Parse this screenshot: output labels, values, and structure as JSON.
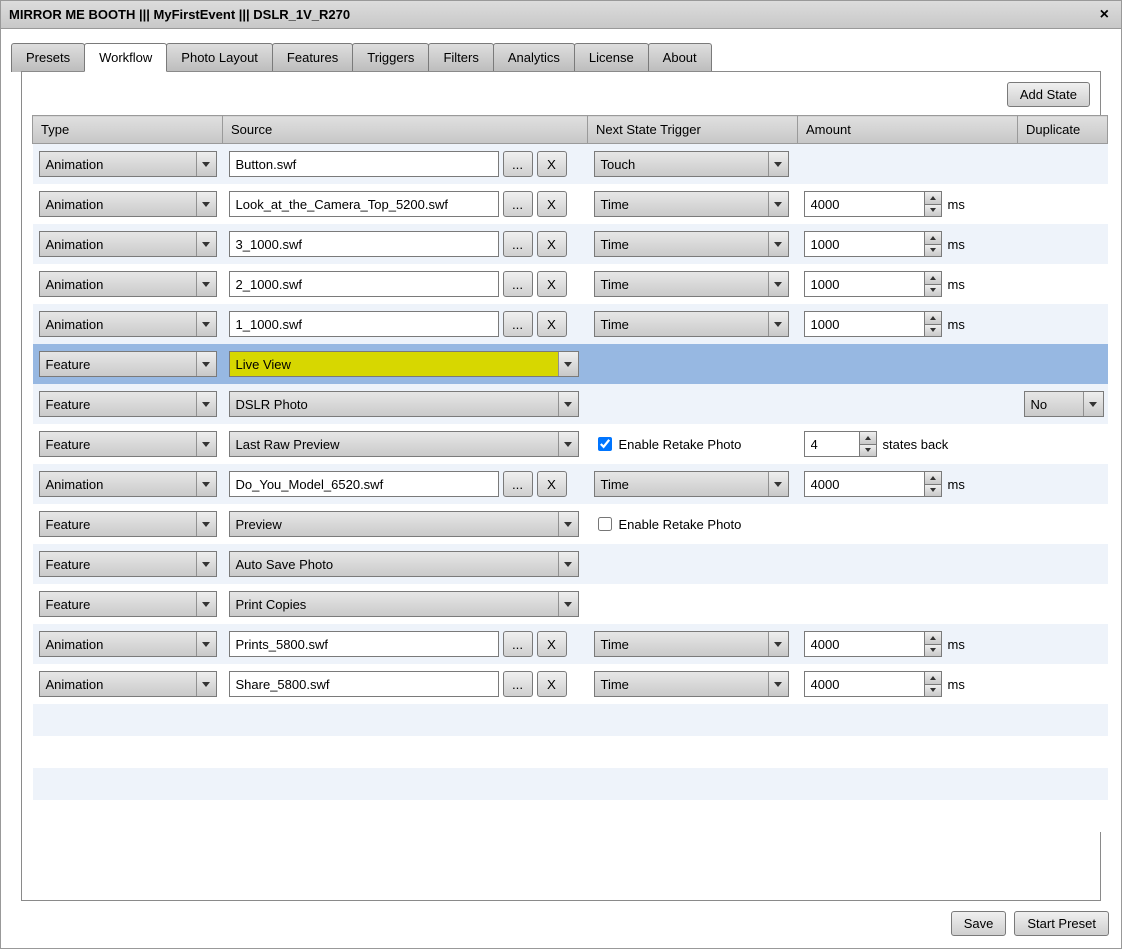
{
  "title": "MIRROR ME BOOTH ||| MyFirstEvent ||| DSLR_1V_R270",
  "tabs": [
    "Presets",
    "Workflow",
    "Photo Layout",
    "Features",
    "Triggers",
    "Filters",
    "Analytics",
    "License",
    "About"
  ],
  "active_tab": 1,
  "buttons": {
    "add_state": "Add State",
    "save": "Save",
    "start_preset": "Start Preset",
    "browse": "...",
    "remove": "X"
  },
  "headers": {
    "type": "Type",
    "source": "Source",
    "trigger": "Next State Trigger",
    "amount": "Amount",
    "duplicate": "Duplicate"
  },
  "labels": {
    "enable_retake": "Enable Retake Photo",
    "ms": "ms",
    "states_back": "states back"
  },
  "rows": [
    {
      "type": "Animation",
      "src_kind": "file",
      "source": "Button.swf",
      "trigger": "Touch",
      "amount": null,
      "unit": null
    },
    {
      "type": "Animation",
      "src_kind": "file",
      "source": "Look_at_the_Camera_Top_5200.swf",
      "trigger": "Time",
      "amount": "4000",
      "unit": "ms"
    },
    {
      "type": "Animation",
      "src_kind": "file",
      "source": "3_1000.swf",
      "trigger": "Time",
      "amount": "1000",
      "unit": "ms"
    },
    {
      "type": "Animation",
      "src_kind": "file",
      "source": "2_1000.swf",
      "trigger": "Time",
      "amount": "1000",
      "unit": "ms"
    },
    {
      "type": "Animation",
      "src_kind": "file",
      "source": "1_1000.swf",
      "trigger": "Time",
      "amount": "1000",
      "unit": "ms"
    },
    {
      "type": "Feature",
      "src_kind": "combo",
      "source": "Live View",
      "selected": true,
      "highlight": true
    },
    {
      "type": "Feature",
      "src_kind": "combo",
      "source": "DSLR Photo",
      "duplicate": "No"
    },
    {
      "type": "Feature",
      "src_kind": "combo",
      "source": "Last Raw Preview",
      "retake_chk": true,
      "retake_checked": true,
      "amount": "4",
      "unit": "states back"
    },
    {
      "type": "Animation",
      "src_kind": "file",
      "source": "Do_You_Model_6520.swf",
      "trigger": "Time",
      "amount": "4000",
      "unit": "ms"
    },
    {
      "type": "Feature",
      "src_kind": "combo",
      "source": "Preview",
      "retake_chk": true,
      "retake_checked": false
    },
    {
      "type": "Feature",
      "src_kind": "combo",
      "source": "Auto Save Photo"
    },
    {
      "type": "Feature",
      "src_kind": "combo",
      "source": "Print Copies"
    },
    {
      "type": "Animation",
      "src_kind": "file",
      "source": "Prints_5800.swf",
      "trigger": "Time",
      "amount": "4000",
      "unit": "ms"
    },
    {
      "type": "Animation",
      "src_kind": "file",
      "source": "Share_5800.swf",
      "trigger": "Time",
      "amount": "4000",
      "unit": "ms"
    }
  ],
  "empty_rows": 4
}
